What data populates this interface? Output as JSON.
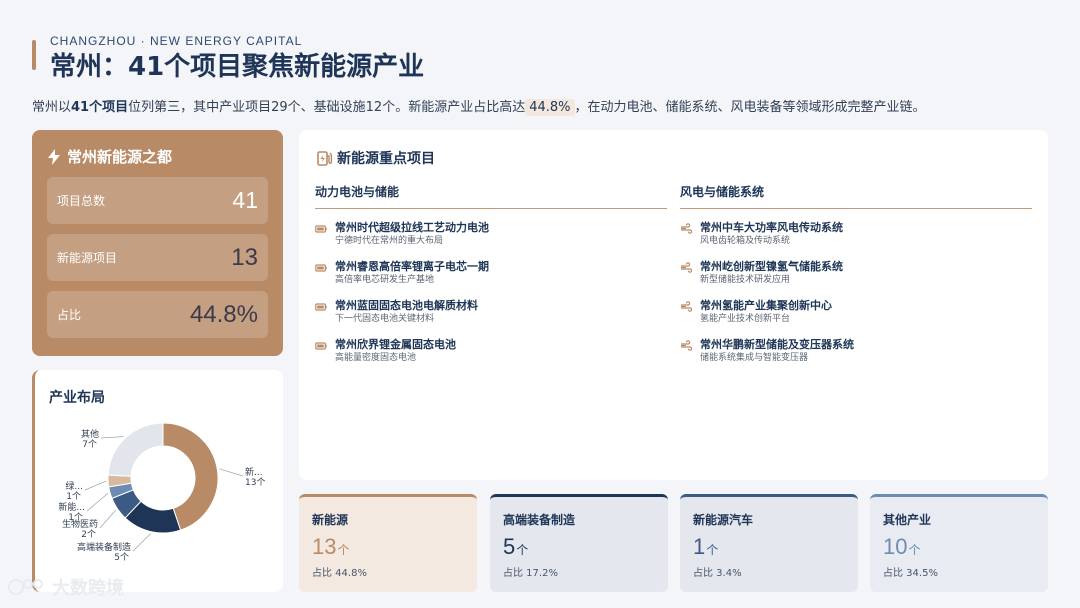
{
  "header": {
    "eyebrow": "CHANGZHOU · NEW ENERGY CAPITAL",
    "title": "常州：41个项目聚焦新能源产业",
    "intro_parts": [
      "常州以",
      "41个项目",
      "位列第三，其中产业项目29个、基础设施12个。新能源产业占比高达",
      "44.8%",
      "，在动力电池、储能系统、风电装备等领域形成完整产业链。"
    ]
  },
  "stats": {
    "title": "常州新能源之都",
    "rows": [
      {
        "label": "项目总数",
        "value": "41"
      },
      {
        "label": "新能源项目",
        "value": "13"
      },
      {
        "label": "占比",
        "value": "44.8%"
      }
    ]
  },
  "layout": {
    "title": "产业布局",
    "chart_data": {
      "type": "pie",
      "categories": [
        "新能源",
        "高端装备制造",
        "生物医药",
        "新能源汽车",
        "绿色…",
        "其他"
      ],
      "values": [
        13,
        5,
        2,
        1,
        1,
        7
      ],
      "slice_labels": [
        {
          "name": "新...",
          "count": "13个"
        },
        {
          "name": "高端装备制造",
          "count": "5个"
        },
        {
          "name": "生物医药",
          "count": "2个"
        },
        {
          "name": "新能...",
          "count": "1个"
        },
        {
          "name": "绿...",
          "count": "1个"
        },
        {
          "name": "其他",
          "count": "7个"
        }
      ],
      "colors": [
        "#b88a66",
        "#1f3557",
        "#3d5a85",
        "#6d8bb5",
        "#d8b9a0",
        "#e2e6ec"
      ]
    }
  },
  "projects": {
    "title": "新能源重点项目",
    "columns": [
      {
        "heading": "动力电池与储能",
        "icon": "battery-icon",
        "items": [
          {
            "name": "常州时代超级拉线工艺动力电池",
            "desc": "宁德时代在常州的重大布局"
          },
          {
            "name": "常州睿恩高倍率锂离子电芯一期",
            "desc": "高倍率电芯研发生产基地"
          },
          {
            "name": "常州蓝固固态电池电解质材料",
            "desc": "下一代固态电池关键材料"
          },
          {
            "name": "常州欣界锂金属固态电池",
            "desc": "高能量密度固态电池"
          }
        ]
      },
      {
        "heading": "风电与储能系统",
        "icon": "wind-icon",
        "items": [
          {
            "name": "常州中车大功率风电传动系统",
            "desc": "风电齿轮箱及传动系统"
          },
          {
            "name": "常州屹创新型镍氢气储能系统",
            "desc": "新型储能技术研发应用"
          },
          {
            "name": "常州氢能产业集聚创新中心",
            "desc": "氢能产业技术创新平台"
          },
          {
            "name": "常州华鹏新型储能及变压器系统",
            "desc": "储能系统集成与智能变压器"
          }
        ]
      }
    ]
  },
  "categories": [
    {
      "name": "新能源",
      "value": "13",
      "unit": "个",
      "share": "占比 44.8%",
      "accent": "#b88a66",
      "bg": "#f4e9e0",
      "valColor": "#b88a66"
    },
    {
      "name": "高端装备制造",
      "value": "5",
      "unit": "个",
      "share": "占比 17.2%",
      "accent": "#1f3557",
      "bg": "#e4e8ee",
      "valColor": "#1f3557"
    },
    {
      "name": "新能源汽车",
      "value": "1",
      "unit": "个",
      "share": "占比 3.4%",
      "accent": "#3d5a85",
      "bg": "#e4e8ee",
      "valColor": "#3d5a85"
    },
    {
      "name": "其他产业",
      "value": "10",
      "unit": "个",
      "share": "占比 34.5%",
      "accent": "#6d8bb5",
      "bg": "#e8ecf2",
      "valColor": "#6d8bb5"
    }
  ],
  "watermark": "大数跨境"
}
